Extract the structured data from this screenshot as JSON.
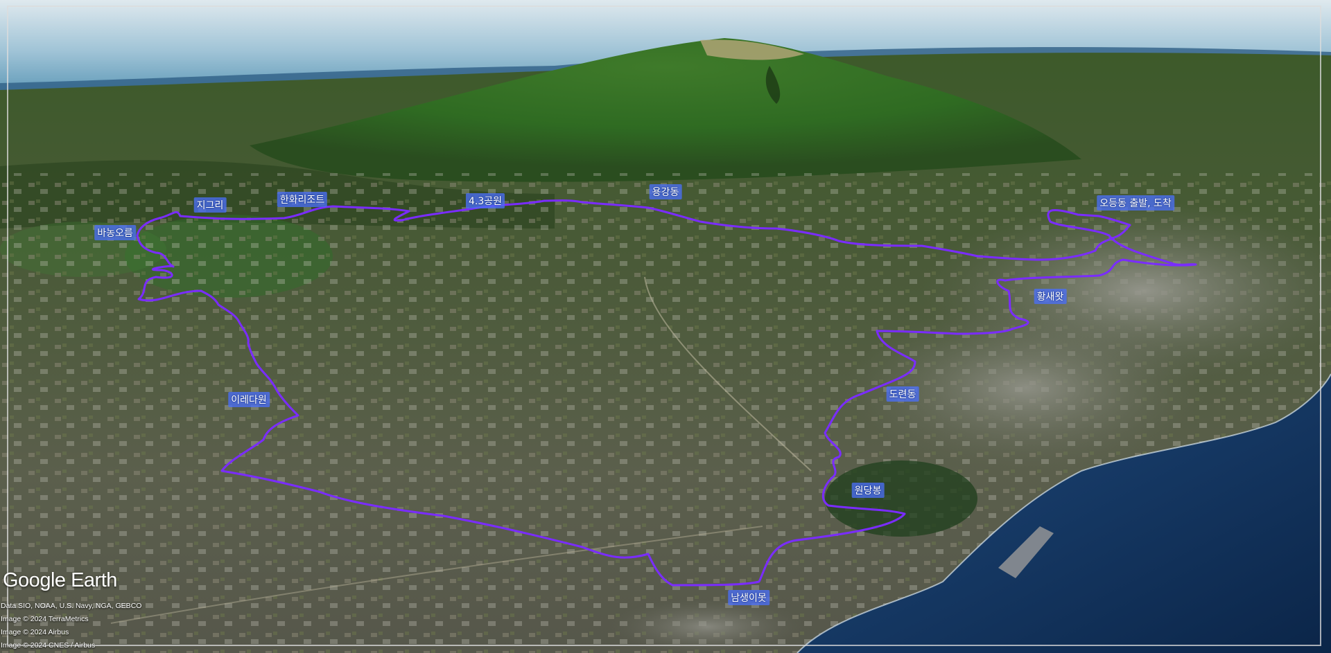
{
  "map": {
    "labels": [
      {
        "name": "start-finish",
        "text": "오등동 출발, 도착"
      },
      {
        "name": "yonggang",
        "text": "용강동"
      },
      {
        "name": "park-43",
        "text": "4.3공원"
      },
      {
        "name": "hanwha-resort",
        "text": "한화리조트"
      },
      {
        "name": "jigeuri",
        "text": "지그리"
      },
      {
        "name": "banong-oreum",
        "text": "바농오름"
      },
      {
        "name": "hwangsaewat",
        "text": "황새왓"
      },
      {
        "name": "doryeondong",
        "text": "도련동"
      },
      {
        "name": "iredawon",
        "text": "이레다원"
      },
      {
        "name": "wondangbong",
        "text": "원당봉"
      },
      {
        "name": "namsaengimot",
        "text": "남생이못"
      }
    ],
    "route_color": "#7a2cff",
    "label_color": "#4a6ef6"
  },
  "branding": {
    "logo": "Google Earth",
    "credits": [
      "Data SIO, NOAA, U.S. Navy, NGA, GEBCO",
      "Image © 2024 TerraMetrics",
      "Image © 2024 Airbus",
      "Image © 2024 CNES / Airbus"
    ]
  }
}
